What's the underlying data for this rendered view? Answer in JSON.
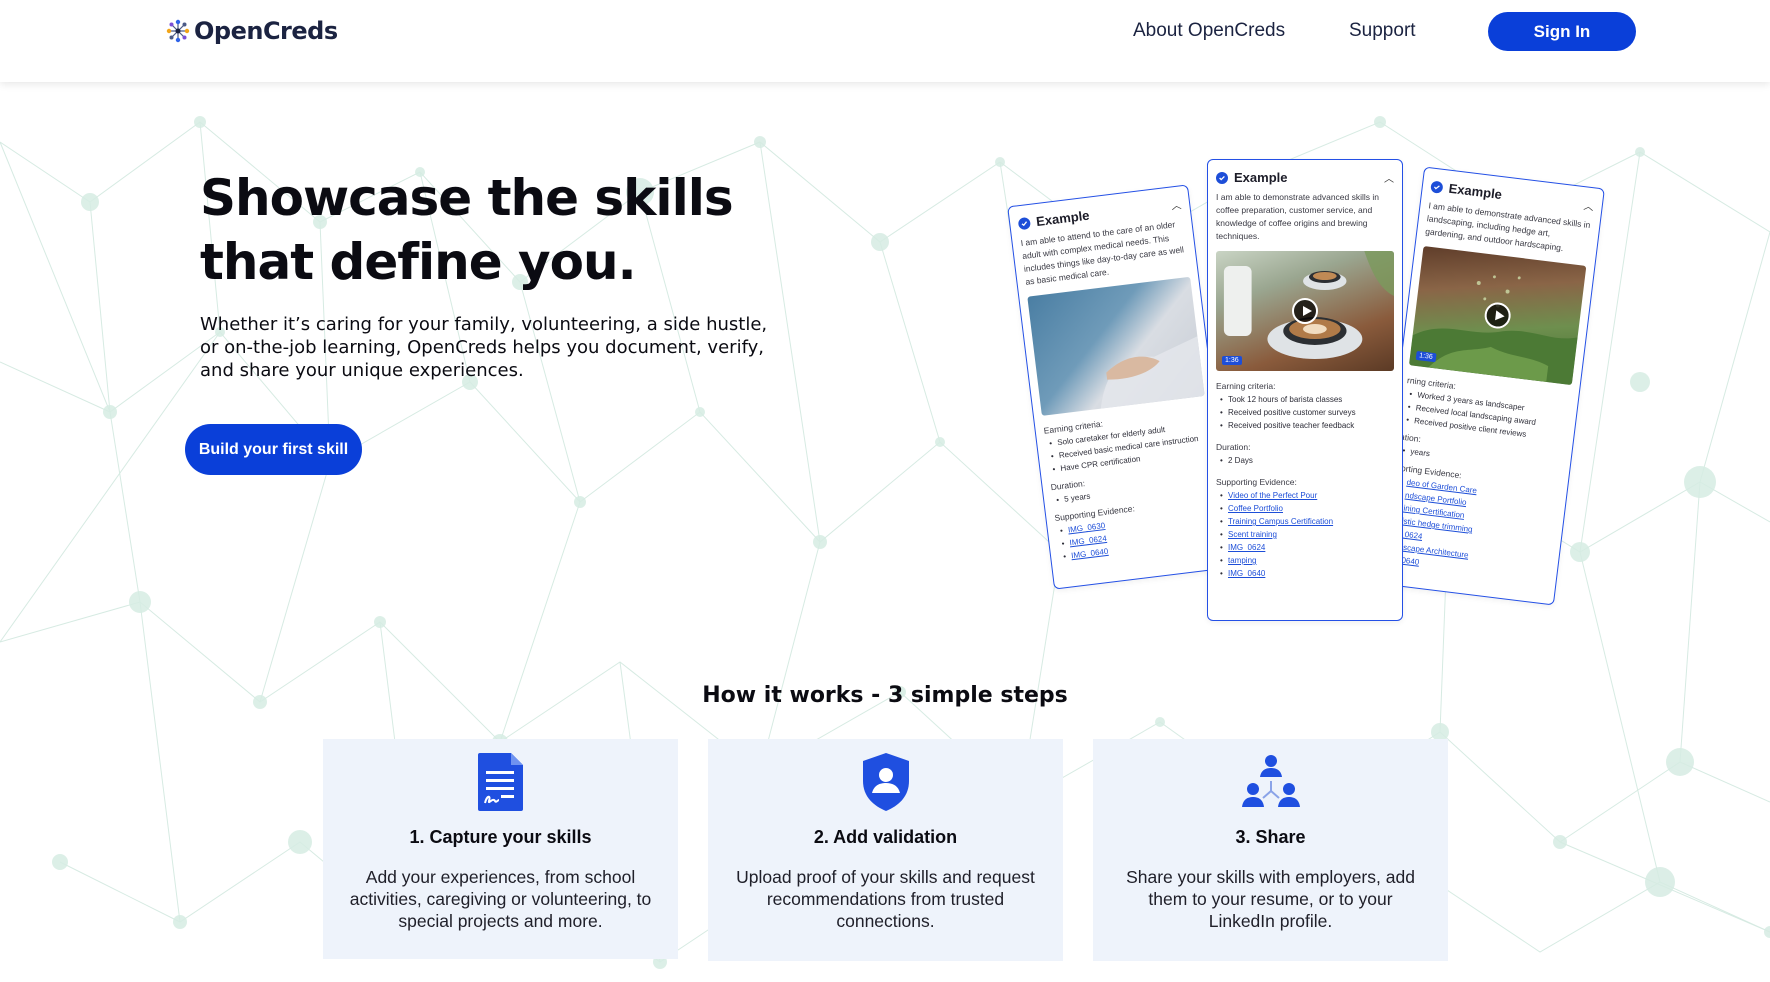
{
  "brand": {
    "name": "OpenCreds",
    "primary_color": "#0a3fd9"
  },
  "nav": {
    "about": "About OpenCreds",
    "support": "Support",
    "signin": "Sign In"
  },
  "hero": {
    "title_line1": "Showcase the skills",
    "title_line2": "that define you.",
    "subtitle": "Whether it’s caring for your family, volunteering, a side hustle, or on-the-job learning, OpenCreds helps you document, verify, and share your unique experiences.",
    "cta": "Build your first skill"
  },
  "example_cards": [
    {
      "title": "Example",
      "description": "I am able to attend to the care of an older adult with complex medical needs. This includes things like day-to-day care as well as basic medical care.",
      "criteria_label": "Earning criteria:",
      "criteria": [
        "Solo caretaker for elderly adult",
        "Received basic medical care instruction",
        "Have CPR certification"
      ],
      "duration_label": "Duration:",
      "duration": "5 years",
      "evidence_label": "Supporting Evidence:",
      "evidence": [
        "IMG_0630",
        "IMG_0624",
        "IMG_0640"
      ]
    },
    {
      "title": "Example",
      "description": "I am able to demonstrate advanced skills in coffee preparation, customer service, and knowledge of coffee origins and brewing techniques.",
      "video_duration": "1:36",
      "criteria_label": "Earning criteria:",
      "criteria": [
        "Took 12 hours of barista classes",
        "Received positive customer surveys",
        "Received positive teacher feedback"
      ],
      "duration_label": "Duration:",
      "duration": "2 Days",
      "evidence_label": "Supporting Evidence:",
      "evidence": [
        "Video of the Perfect Pour",
        "Coffee Portfolio",
        "Training Campus Certification",
        "Scent training",
        "IMG_0624",
        "tamping",
        "IMG_0640"
      ]
    },
    {
      "title": "Example",
      "description": "I am able to demonstrate advanced skills in landscaping, including hedge art, gardening, and outdoor hardscaping.",
      "video_duration": "1:36",
      "criteria_label": "rning criteria:",
      "criteria": [
        "Worked 3 years as landscaper",
        "Received local landscaping award",
        "Received positive client reviews"
      ],
      "duration_label": "ation:",
      "duration": "years",
      "evidence_label": "porting Evidence:",
      "evidence": [
        "deo of Garden Care",
        "ndscape Portfolio",
        "ining Certification",
        "istic hedge trimming",
        "_0624",
        "dscape Architecture",
        "_0640"
      ]
    }
  ],
  "how_it_works": {
    "title": "How it works - 3 simple steps",
    "steps": [
      {
        "title": "1.  Capture your skills",
        "text": "Add your experiences, from school activities, caregiving or volunteering, to special projects and more.",
        "icon": "document-signature-icon"
      },
      {
        "title": "2.  Add validation",
        "text": "Upload proof of your skills and request recommendations from trusted connections.",
        "icon": "shield-user-icon"
      },
      {
        "title": "3.  Share",
        "text": "Share your skills with employers, add them to your resume, or to your LinkedIn profile.",
        "icon": "people-network-icon"
      }
    ]
  }
}
